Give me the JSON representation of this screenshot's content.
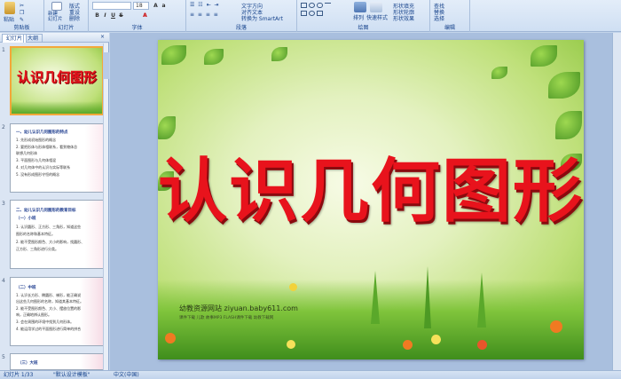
{
  "ribbon": {
    "clipboard": {
      "paste": "粘贴",
      "label": "剪贴板"
    },
    "slides": {
      "new_slide": "新建\n幻灯片",
      "layout": "版式",
      "reset": "重设",
      "delete": "删除",
      "label": "幻灯片"
    },
    "font": {
      "label": "字体",
      "font_size": "18",
      "bold": "B",
      "italic": "I",
      "underline": "U",
      "strike": "S"
    },
    "paragraph": {
      "label": "段落",
      "text_direction": "文字方向",
      "align_text": "对齐文本",
      "smartart": "转换为 SmartArt"
    },
    "drawing": {
      "label": "绘图",
      "arrange": "排列",
      "quick_styles": "快速样式",
      "shape_fill": "形状填充",
      "shape_outline": "形状轮廓",
      "shape_effects": "形状效果"
    },
    "editing": {
      "label": "编辑",
      "find": "查找",
      "replace": "替换",
      "select": "选择"
    }
  },
  "left_panel": {
    "tabs": [
      "幻灯片",
      "大纲"
    ],
    "thumbnails": [
      {
        "num": "1",
        "title": "认识几何图形"
      },
      {
        "num": "2",
        "lines": [
          "一、幼儿认识几何图形的特点",
          "1. 先形成初始图形的概念",
          "2. 要把形体与形体相联系，看到物体总",
          "联想几何形体",
          "3. 平面图形与几何体相混",
          "4. 对几何体中的认识与实际等联系",
          "5. 没有形成图形守恒的概念"
        ]
      },
      {
        "num": "3",
        "lines": [
          "二、幼儿认识几何图形的教育目标",
          "（一）小班",
          "1. 认识圆形、正方形、三角形，知道这些",
          "图形的名称和基本特征。",
          "2. 能不受图形颜色、大小的影响，找圆形、",
          "正方形、三角形进行分类。"
        ]
      },
      {
        "num": "4",
        "lines": [
          "（二）中班",
          "1. 认识长方形、椭圆形、梯形，能正确说",
          "出这些几何图形的名称，知道其基本特征。",
          "2. 能不受图形颜色、大小、摆放位置的影",
          "响，正确地辨认图形。",
          "3. 会在周围的环境中找到几何形体。",
          "4. 能运用学过的平面图形进行简单的拼合"
        ]
      },
      {
        "num": "5",
        "lines": [
          "（三）大班"
        ]
      }
    ]
  },
  "slide": {
    "title": "认识几何图形",
    "watermark": "幼教资源网站   ziyuan.baby611.com",
    "watermark_sub": "课件下载  儿歌  故事MP3  FLASH课件下载  幼教下载网"
  },
  "status": {
    "slide_index": "幻灯片 1/33",
    "theme": "\"默认设计模板\"",
    "language": "中文(中国)"
  }
}
